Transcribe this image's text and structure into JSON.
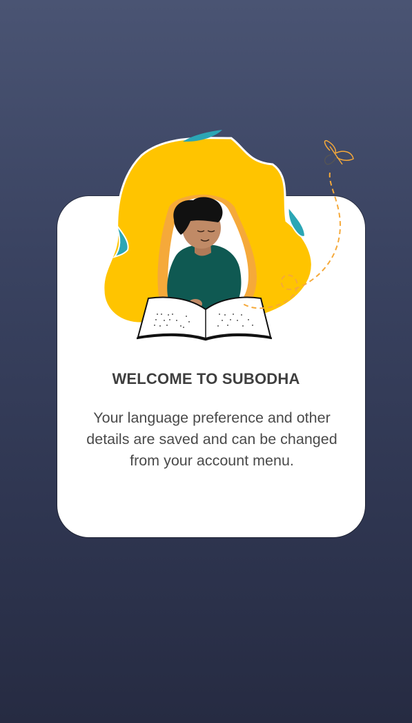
{
  "welcome": {
    "title": "WELCOME TO SUBODHA",
    "message": "Your language preference and other details are saved and can be changed from your account menu."
  },
  "illustration": {
    "subject": "person-reading-braille-book",
    "blob_color": "#ffc400",
    "accent_color": "#2ba6b5",
    "shirt_color": "#0f5952",
    "skin_color": "#c08a66",
    "hair_color": "#111111"
  },
  "colors": {
    "background_top": "#4a5473",
    "background_bottom": "#262b42",
    "card": "#ffffff",
    "title_text": "#3f3f3f",
    "body_text": "#4a4a4a"
  }
}
